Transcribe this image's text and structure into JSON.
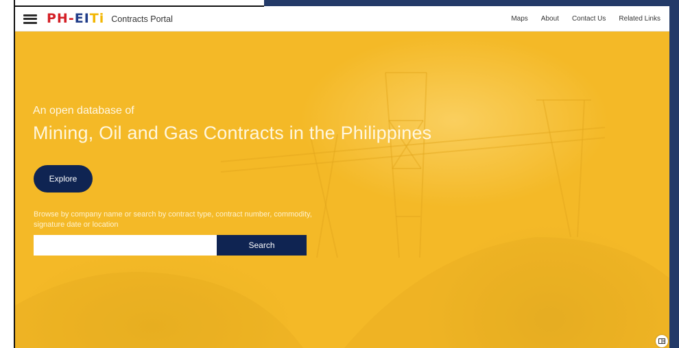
{
  "window": {
    "frame_accent": "#233a68"
  },
  "navbar": {
    "menu_icon": "hamburger-menu-icon",
    "logo": {
      "part1": "PH",
      "dash": "-",
      "part2": "EI",
      "part3": "Ti"
    },
    "portal_title": "Contracts Portal",
    "links": [
      "Maps",
      "About",
      "Contact Us",
      "Related Links"
    ]
  },
  "hero": {
    "background": "#f4b927",
    "subheading": "An open database of",
    "headline": "Mining, Oil and Gas Contracts in the Philippines",
    "explore_label": "Explore",
    "browse_text": "Browse by company name or search by contract type, contract number, commodity, signature date or location",
    "search": {
      "value": "",
      "placeholder": "",
      "button_label": "Search"
    }
  },
  "colors": {
    "primary_dark": "#0f2452",
    "logo_red": "#d42027",
    "logo_blue": "#1f3c88",
    "logo_yellow": "#f2b705"
  },
  "corner_widget": {
    "icon": "reader-view-icon"
  }
}
